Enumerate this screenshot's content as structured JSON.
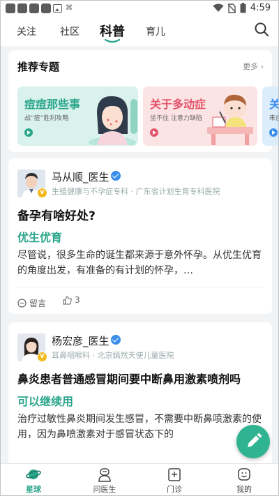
{
  "status_bar": {
    "time": "4:59"
  },
  "top_nav": {
    "tabs": [
      {
        "label": "关注"
      },
      {
        "label": "社区"
      },
      {
        "label": "科普",
        "active": true
      },
      {
        "label": "育儿"
      }
    ]
  },
  "recommended": {
    "title": "推荐专题",
    "more": "更多",
    "topics": [
      {
        "title": "痘痘那些事",
        "subtitle": "战“痘”胜利攻略"
      },
      {
        "title": "关于多动症",
        "subtitle": "坐不住 注意力缺陷"
      },
      {
        "title": "关",
        "subtitle": "来自"
      }
    ]
  },
  "posts": [
    {
      "doctor_name": "马从顺_医生",
      "doctor_info": "生殖健康与不孕症专科 · 广东省计划生育专科医院",
      "title": "备孕有啥好处?",
      "highlight": "优生优育",
      "body": "尽管说，很多生命的诞生都来源于意外怀孕。从优生优育的角度出发，有准备的有计划的怀孕，…",
      "comment_label": "留言",
      "likes": "3"
    },
    {
      "doctor_name": "杨宏彦_医生",
      "doctor_info": "耳鼻咽喉科 · 北京嫣然天使儿童医院",
      "title": "鼻炎患者普通感冒期间要中断鼻用激素喷剂吗",
      "highlight": "可以继续用",
      "body": "治疗过敏性鼻炎期间发生感冒，不需要中断鼻喷激素的使用，因为鼻喷激素对于感冒状态下的"
    }
  ],
  "bottom_nav": {
    "items": [
      {
        "label": "星球",
        "active": true
      },
      {
        "label": "问医生"
      },
      {
        "label": "门诊"
      },
      {
        "label": "我的"
      }
    ]
  },
  "colors": {
    "accent": "#2aa58b",
    "fab": "#2fb391",
    "verify": "#3b8eea"
  }
}
